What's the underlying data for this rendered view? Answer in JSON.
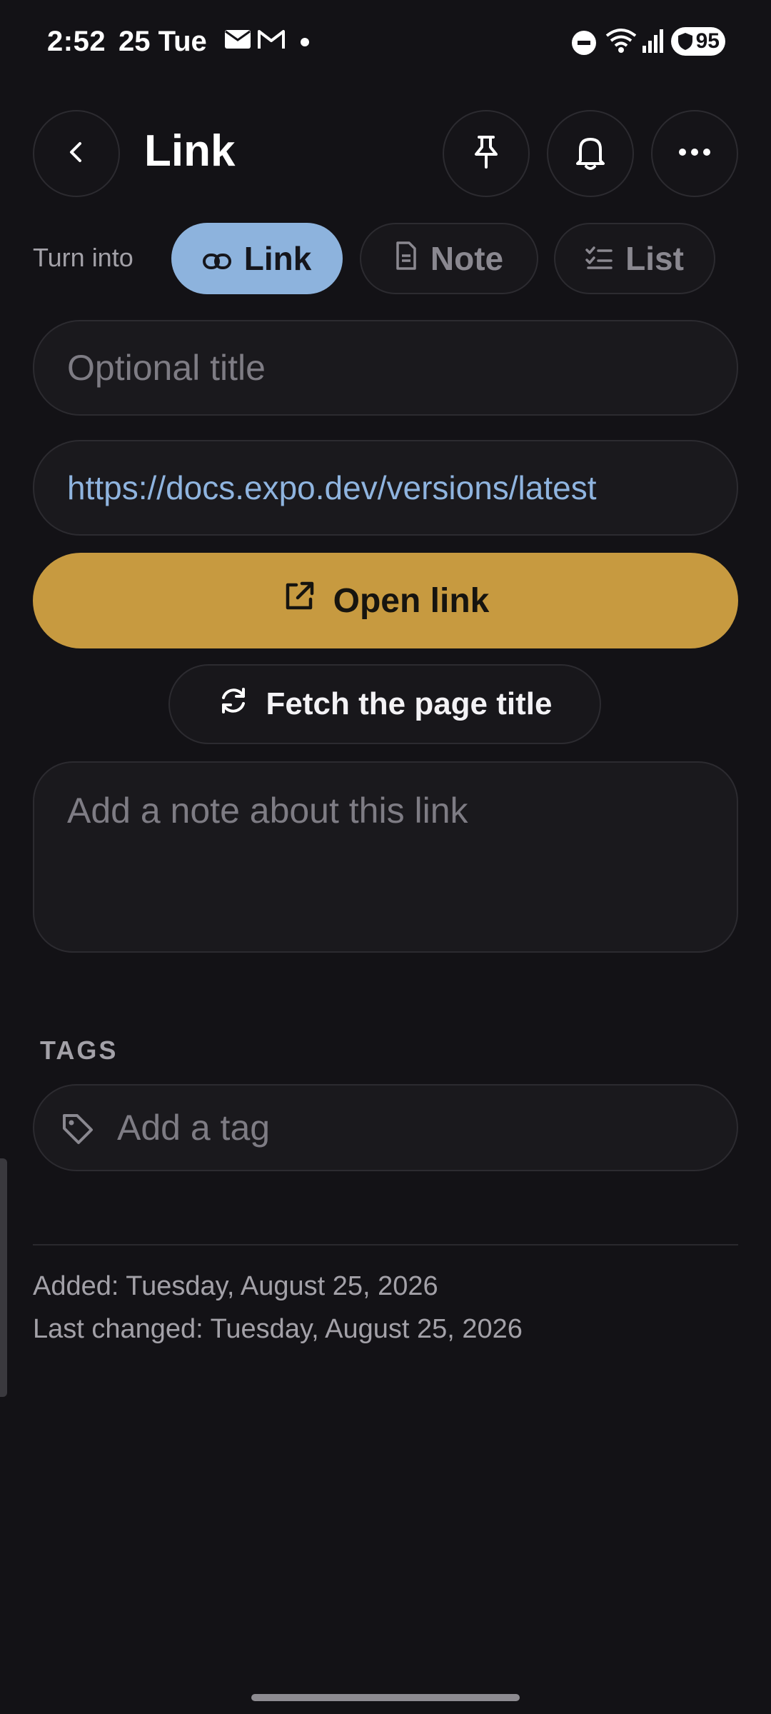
{
  "status_bar": {
    "time": "2:52",
    "date": "25 Tue",
    "battery": "95",
    "icons": [
      "mail-icon",
      "gmail-icon",
      "dot-icon",
      "dnd-icon",
      "wifi-icon",
      "signal-icon",
      "battery-icon"
    ]
  },
  "header": {
    "title": "Link",
    "back_icon": "chevron-left-icon",
    "actions": [
      "pin-icon",
      "bell-icon",
      "more-icon"
    ]
  },
  "turn_into": {
    "label": "Turn into",
    "options": [
      {
        "label": "Link",
        "icon": "link-icon",
        "active": true
      },
      {
        "label": "Note",
        "icon": "document-icon",
        "active": false
      },
      {
        "label": "List",
        "icon": "checklist-icon",
        "active": false
      }
    ]
  },
  "title_field": {
    "placeholder": "Optional title"
  },
  "url_field": {
    "value": "https://docs.expo.dev/versions/latest"
  },
  "open_link": {
    "label": "Open link",
    "icon": "external-link-icon"
  },
  "fetch_title": {
    "label": "Fetch the page title",
    "icon": "refresh-icon"
  },
  "note_field": {
    "placeholder": "Add a note about this link"
  },
  "tags": {
    "heading": "TAGS",
    "placeholder": "Add a tag",
    "icon": "tag-icon"
  },
  "meta": {
    "added": "Added: Tuesday, August 25, 2026",
    "last_changed": "Last changed: Tuesday, August 25, 2026"
  },
  "colors": {
    "background": "#131216",
    "active_chip": "#8db3dd",
    "primary_button": "#c79a40",
    "link_text": "#8fb4df"
  }
}
